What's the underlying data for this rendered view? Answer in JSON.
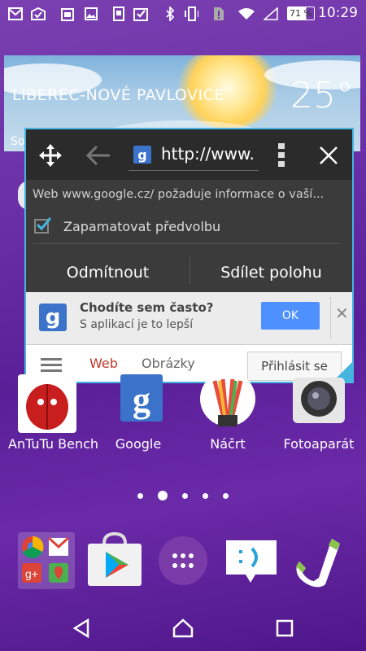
{
  "status": {
    "time": "10:29",
    "battery": "71 %",
    "icons": [
      "gmail-icon",
      "mail-done-icon",
      "calendar-icon",
      "image-icon",
      "screenshot-icon",
      "task-icon",
      "bluetooth-icon",
      "vibrate-icon",
      "sim-alert-icon",
      "wifi-icon",
      "signal-icon",
      "battery-icon"
    ]
  },
  "weather": {
    "city": "LIBEREC-NOVÉ PAVLOVICE",
    "temperature": "25°",
    "partial": "So"
  },
  "browser": {
    "url": "http://www.",
    "permission_text": "Web www.google.cz/ požaduje informace o vaší...",
    "remember_label": "Zapamatovat předvolbu",
    "remember_checked": true,
    "deny_label": "Odmítnout",
    "share_label": "Sdílet polohu",
    "promo_title": "Chodíte sem často?",
    "promo_sub": "S aplikací je to lepší",
    "ok_label": "OK",
    "tab_web": "Web",
    "tab_images": "Obrázky",
    "signin_label": "Přihlásit se",
    "accent": "#45b5e0"
  },
  "apps": [
    {
      "label": "AnTuTu Bench"
    },
    {
      "label": "Google"
    },
    {
      "label": "Náčrt"
    },
    {
      "label": "Fotoaparát"
    }
  ],
  "pager": {
    "count": 5,
    "active": 1
  }
}
